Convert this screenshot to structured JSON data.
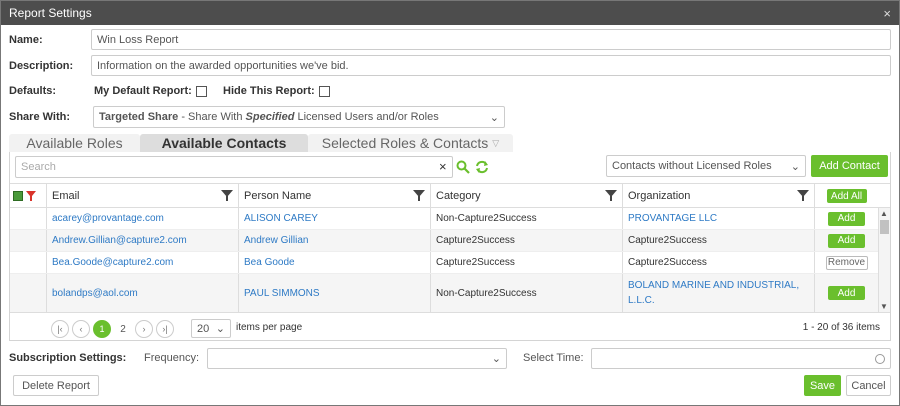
{
  "dialog": {
    "title": "Report Settings",
    "close_glyph": "×"
  },
  "form": {
    "name_label": "Name:",
    "name_value": "Win Loss Report",
    "description_label": "Description:",
    "description_value": "Information on the awarded opportunities we've bid.",
    "defaults_label": "Defaults:",
    "my_default_label": "My Default Report:",
    "hide_label": "Hide This Report:",
    "share_label": "Share With:",
    "share_bold": "Targeted Share",
    "share_mid": " - Share With ",
    "share_em": "Specified",
    "share_rest": " Licensed Users and/or Roles"
  },
  "tabs": [
    {
      "label": "Available Roles"
    },
    {
      "label": "Available Contacts"
    },
    {
      "label": "Selected Roles & Contacts"
    }
  ],
  "toolbar": {
    "search_placeholder": "Search",
    "clear_glyph": "×",
    "filter_value": "Contacts without Licensed Roles",
    "add_contact": "Add Contact"
  },
  "grid": {
    "columns": [
      "Email",
      "Person Name",
      "Category",
      "Organization"
    ],
    "add_all": "Add All",
    "rows": [
      {
        "email": "acarey@provantage.com",
        "name": "ALISON CAREY",
        "category": "Non-Capture2Success",
        "org": "PROVANTAGE LLC",
        "org_link": true,
        "action": "Add"
      },
      {
        "email": "Andrew.Gillian@capture2.com",
        "name": "Andrew Gillian",
        "category": "Capture2Success",
        "org": "Capture2Success",
        "org_link": false,
        "action": "Add"
      },
      {
        "email": "Bea.Goode@capture2.com",
        "name": "Bea Goode",
        "category": "Capture2Success",
        "org": "Capture2Success",
        "org_link": false,
        "action": "Remove"
      },
      {
        "email": "bolandps@aol.com",
        "name": "PAUL SIMMONS",
        "category": "Non-Capture2Success",
        "org": "BOLAND MARINE AND INDUSTRIAL, L.L.C.",
        "org_link": true,
        "action": "Add"
      }
    ]
  },
  "pager": {
    "first": "|‹",
    "prev": "‹",
    "page1": "1",
    "page2": "2",
    "next": "›",
    "last": "›|",
    "page_size": "20",
    "items_per_page": "items per page",
    "summary": "1 - 20 of 36 items"
  },
  "subscription": {
    "label": "Subscription Settings:",
    "frequency_label": "Frequency:",
    "time_label": "Select Time:"
  },
  "footer": {
    "delete": "Delete Report",
    "save": "Save",
    "cancel": "Cancel"
  },
  "colors": {
    "accent": "#6abf2d",
    "link": "#2e7ac5",
    "titlebar": "#4d4d4d"
  }
}
